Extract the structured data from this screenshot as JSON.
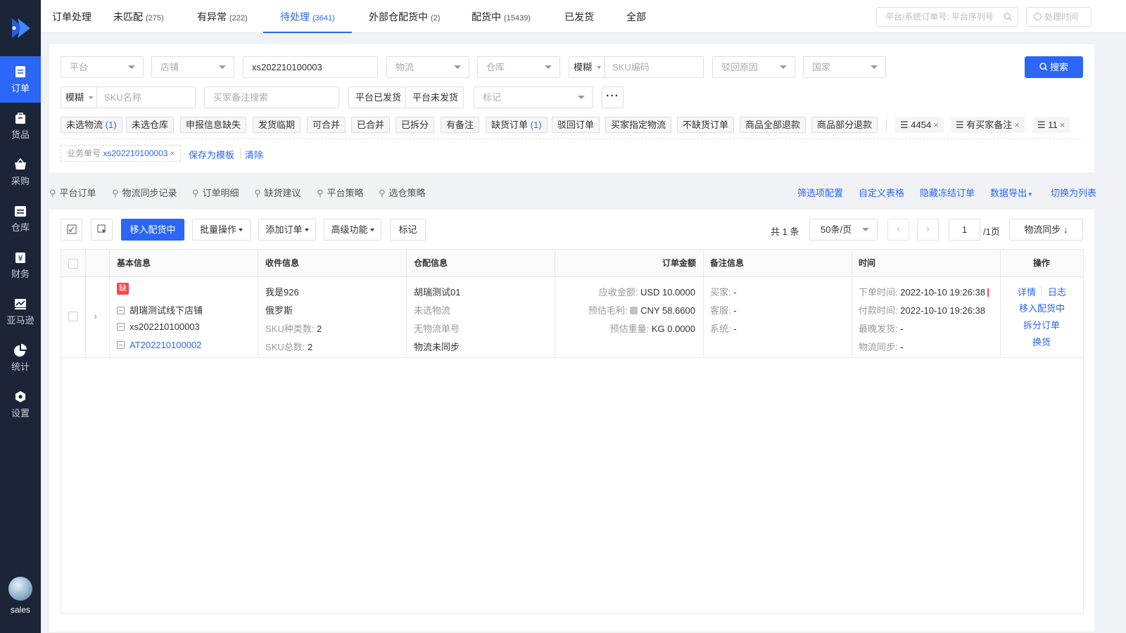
{
  "colors": {
    "accent": "#2b66f6",
    "sidebar": "#1c2538",
    "danger": "#f5484d"
  },
  "sidebar": {
    "items": [
      {
        "label": "订单",
        "icon": "order-icon"
      },
      {
        "label": "货品",
        "icon": "goods-icon"
      },
      {
        "label": "采购",
        "icon": "purchase-icon"
      },
      {
        "label": "仓库",
        "icon": "warehouse-icon"
      },
      {
        "label": "财务",
        "icon": "finance-icon"
      },
      {
        "label": "亚马逊",
        "icon": "amazon-icon"
      },
      {
        "label": "统计",
        "icon": "statistics-icon"
      },
      {
        "label": "设置",
        "icon": "settings-icon"
      }
    ],
    "user": "sales"
  },
  "header": {
    "title": "订单处理",
    "tabs": [
      {
        "label": "未匹配",
        "count": "(275)"
      },
      {
        "label": "有异常",
        "count": "(222)"
      },
      {
        "label": "待处理",
        "count": "(3641)"
      },
      {
        "label": "外部仓配货中",
        "count": "(2)"
      },
      {
        "label": "配货中",
        "count": "(15439)"
      },
      {
        "label": "已发货",
        "count": ""
      },
      {
        "label": "全部",
        "count": ""
      }
    ],
    "search_placeholder": "平台/系统订单号: 平台序列号",
    "time_placeholder": "处理时间"
  },
  "filters": {
    "platform": "平台",
    "store": "店铺",
    "order_no": "xs202210100003",
    "logistics": "物流",
    "warehouse": "仓库",
    "sku_code_mode": "模糊",
    "sku_code": "SKU编码",
    "reject_reason": "驳回原因",
    "country": "国家",
    "search_btn": "搜索",
    "sku_name_mode": "模糊",
    "sku_name": "SKU名称",
    "buyer_note": "买家备注搜索",
    "platform_shipped": "平台已发货",
    "platform_unshipped": "平台未发货",
    "mark": "标记",
    "more": "···",
    "tags": [
      {
        "label": "未选物流",
        "count": "(1)"
      },
      {
        "label": "未选仓库",
        "count": ""
      },
      {
        "label": "申报信息缺失",
        "count": ""
      },
      {
        "label": "发货临期",
        "count": ""
      },
      {
        "label": "可合并",
        "count": ""
      },
      {
        "label": "已合并",
        "count": ""
      },
      {
        "label": "已拆分",
        "count": ""
      },
      {
        "label": "有备注",
        "count": ""
      },
      {
        "label": "缺货订单",
        "count": "(1)"
      },
      {
        "label": "驳回订单",
        "count": ""
      },
      {
        "label": "买家指定物流",
        "count": ""
      },
      {
        "label": "不缺货订单",
        "count": ""
      },
      {
        "label": "商品全部退款",
        "count": ""
      },
      {
        "label": "商品部分退款",
        "count": ""
      }
    ],
    "custom_tags": [
      "4454",
      "有买家备注",
      "11"
    ],
    "business_id_label": "业务单号",
    "business_id_value": "xs202210100003",
    "save_template": "保存为模板",
    "clear": "清除"
  },
  "sublinks": [
    "平台订单",
    "物流同步记录",
    "订单明细",
    "缺货建议",
    "平台策略",
    "选仓策略"
  ],
  "right_links": [
    "筛选项配置",
    "自定义表格",
    "隐藏冻结订单",
    "数据导出",
    "切换为列表"
  ],
  "toolbar": {
    "move": "移入配货中",
    "batch": "批量操作",
    "add": "添加订单",
    "advanced": "高级功能",
    "mark": "标记",
    "total": "共 1 条",
    "page_size": "50条/页",
    "page": "1",
    "pages": "/1页",
    "sync": "物流同步"
  },
  "table": {
    "headers": [
      "基本信息",
      "收件信息",
      "仓配信息",
      "订单金额",
      "备注信息",
      "时间",
      "操作"
    ],
    "row": {
      "badge": "缺",
      "store": "胡瑞测试线下店铺",
      "platform_no": "xs202210100003",
      "system_no": "AT202210100002",
      "recipient": "我是926",
      "country": "俄罗斯",
      "sku_types_label": "SKU种类数:",
      "sku_types": "2",
      "sku_total_label": "SKU总数:",
      "sku_total": "2",
      "warehouse": "胡瑞测试01",
      "logistics": "未选物流",
      "tracking": "无物流单号",
      "sync_status": "物流未同步",
      "receivable_label": "应收金额:",
      "receivable": "USD 10.0000",
      "profit_label": "预估毛利:",
      "profit": "CNY 58.6600",
      "weight_label": "预估重量:",
      "weight": "KG 0.0000",
      "buyer_label": "买家:",
      "buyer": "-",
      "cs_label": "客服:",
      "cs": "-",
      "system_label": "系统:",
      "system": "-",
      "order_time_label": "下单时间:",
      "order_time": "2022-10-10 19:26:38",
      "pay_time_label": "付款时间:",
      "pay_time": "2022-10-10 19:26:38",
      "latest_ship_label": "最晚发货:",
      "latest_ship": "-",
      "logistics_sync_label": "物流同步:",
      "logistics_sync": "-",
      "ops": [
        "详情",
        "日志",
        "移入配货中",
        "拆分订单",
        "换货"
      ]
    }
  }
}
